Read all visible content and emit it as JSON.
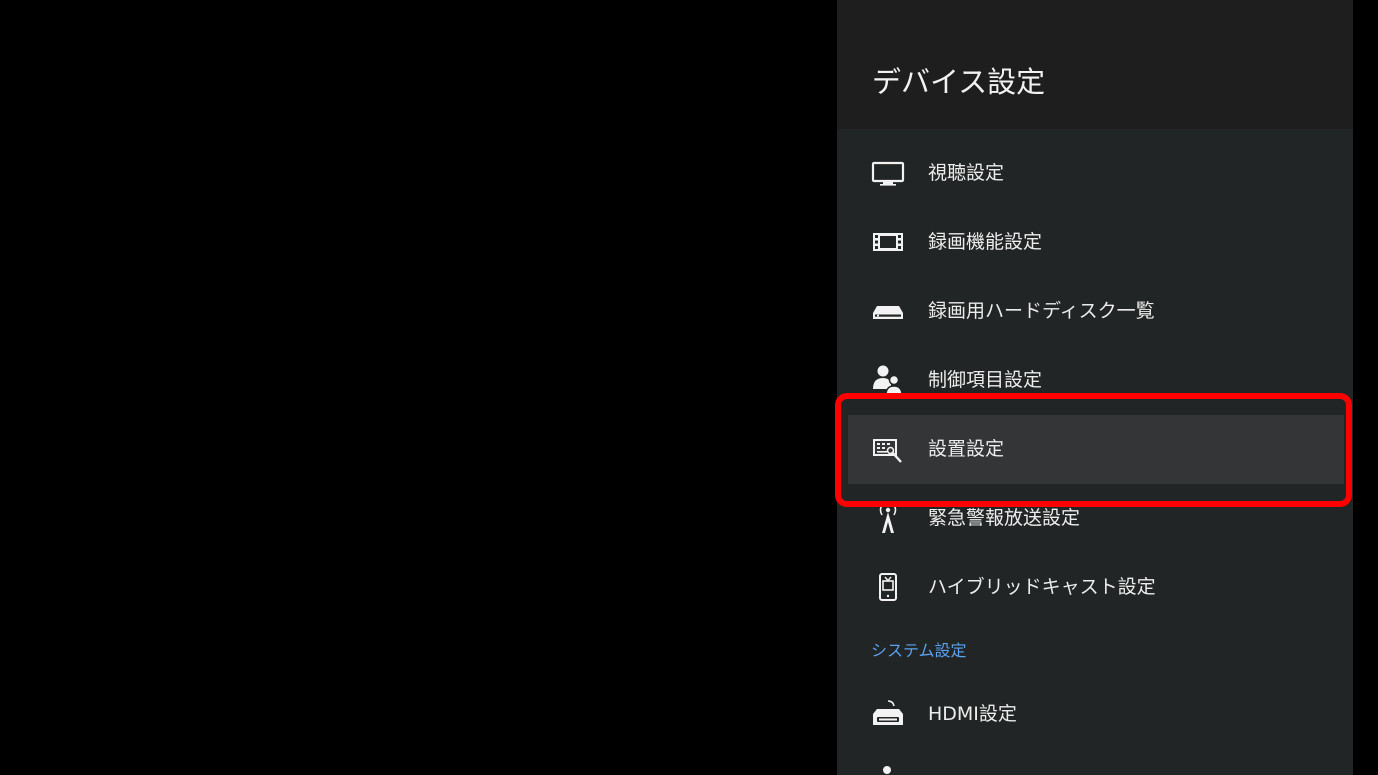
{
  "panel": {
    "title": "デバイス設定"
  },
  "menu": {
    "items": [
      {
        "label": "視聴設定",
        "icon": "tv-monitor-icon"
      },
      {
        "label": "録画機能設定",
        "icon": "film-strip-icon"
      },
      {
        "label": "録画用ハードディスク一覧",
        "icon": "hard-disk-icon"
      },
      {
        "label": "制御項目設定",
        "icon": "users-icon"
      },
      {
        "label": "設置設定",
        "icon": "installation-icon",
        "selected": true
      },
      {
        "label": "緊急警報放送設定",
        "icon": "broadcast-antenna-icon"
      },
      {
        "label": "ハイブリッドキャスト設定",
        "icon": "hybridcast-icon"
      }
    ]
  },
  "system_section": {
    "header": "システム設定",
    "items": [
      {
        "label": "HDMI設定",
        "icon": "hdmi-icon"
      }
    ]
  },
  "colors": {
    "screen_background": "#000000",
    "panel_background": "#222525",
    "header_background": "#1e1e1e",
    "selected_background": "#333537",
    "section_header": "#5aa2ee",
    "highlight_outline": "#ff0000"
  }
}
